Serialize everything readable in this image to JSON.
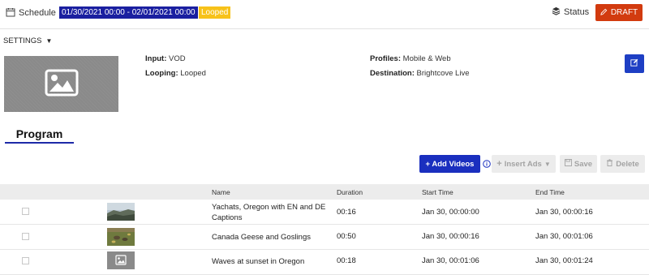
{
  "header": {
    "schedule_label": "Schedule",
    "date_range": "01/30/2021 00:00 - 02/01/2021 00:00",
    "looped_badge": "Looped",
    "status_label": "Status",
    "draft_label": "DRAFT"
  },
  "settings": {
    "toggle_label": "SETTINGS",
    "input_label": "Input:",
    "input_value": "VOD",
    "looping_label": "Looping:",
    "looping_value": "Looped",
    "profiles_label": "Profiles:",
    "profiles_value": "Mobile & Web",
    "destination_label": "Destination:",
    "destination_value": "Brightcove Live"
  },
  "program_tab": "Program",
  "toolbar": {
    "add_videos": "+ Add Videos",
    "insert_ads": "Insert Ads",
    "save": "Save",
    "delete": "Delete"
  },
  "table": {
    "columns": [
      "Name",
      "Duration",
      "Start Time",
      "End Time"
    ],
    "rows": [
      {
        "name": "Yachats, Oregon with EN and DE Captions",
        "duration": "00:16",
        "start": "Jan 30, 00:00:00",
        "end": "Jan 30, 00:00:16",
        "thumb": "coastal-landscape"
      },
      {
        "name": "Canada Geese and Goslings",
        "duration": "00:50",
        "start": "Jan 30, 00:00:16",
        "end": "Jan 30, 00:01:06",
        "thumb": "geese-on-grass"
      },
      {
        "name": "Waves at sunset in Oregon",
        "duration": "00:18",
        "start": "Jan 30, 00:01:06",
        "end": "Jan 30, 00:01:24",
        "thumb": "placeholder-image-icon"
      }
    ]
  },
  "colors": {
    "date_range_bg": "#1a1fa0",
    "looped_bg": "#f7c219",
    "draft_bg": "#d23b0f",
    "primary_blue": "#1a2fbf",
    "tab_underline": "#1e2aa8"
  }
}
